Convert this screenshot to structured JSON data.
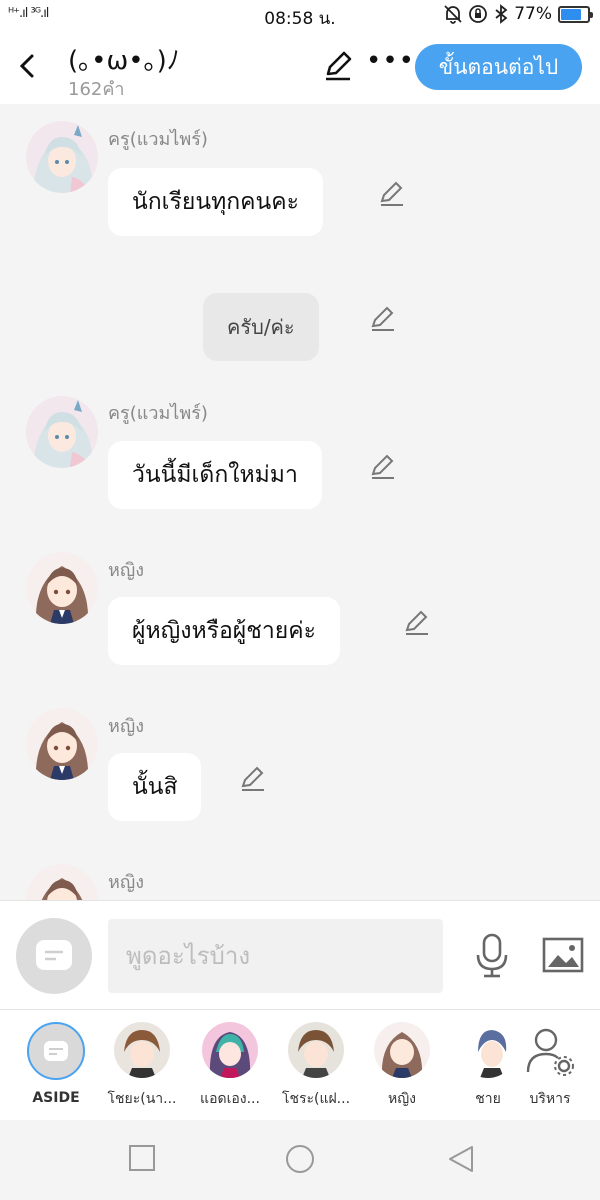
{
  "status_bar": {
    "signal_text": "ᴴ⁺.ıl ³ᴳ.ıl",
    "time": "08:58 น.",
    "battery": "77%",
    "battery_level": 0.77
  },
  "header": {
    "title": "(｡•ω•｡)ﾉ",
    "word_count": "162คำ",
    "next_button": "ขั้นตอนต่อไป"
  },
  "messages": [
    {
      "speaker": "ครู(แวมไพร์)",
      "text": "นักเรียนทุกคนคะ",
      "avatar": "vampire-teacher"
    },
    {
      "speaker": "",
      "text": "ครับ/ค่ะ",
      "avatar": ""
    },
    {
      "speaker": "ครู(แวมไพร์)",
      "text": "วันนี้มีเด็กใหม่มา",
      "avatar": "vampire-teacher"
    },
    {
      "speaker": "หญิง",
      "text": "ผู้หญิงหรือผู้ชายค่ะ",
      "avatar": "girl"
    },
    {
      "speaker": "หญิง",
      "text": "นั้นสิ",
      "avatar": "girl"
    },
    {
      "speaker": "หญิง",
      "text": "",
      "avatar": "girl"
    }
  ],
  "input": {
    "placeholder": "พูดอะไรบ้าง"
  },
  "characters": [
    {
      "label": "ASIDE"
    },
    {
      "label": "โชยะ(นา..."
    },
    {
      "label": "แอดเอง..."
    },
    {
      "label": "โชระ(แฝ..."
    },
    {
      "label": "หญิง"
    },
    {
      "label": "ชาย"
    },
    {
      "label": "บริหาร"
    }
  ],
  "colors": {
    "accent": "#4aa3f0",
    "background": "#f4f4f4",
    "bubble": "#ffffff"
  }
}
